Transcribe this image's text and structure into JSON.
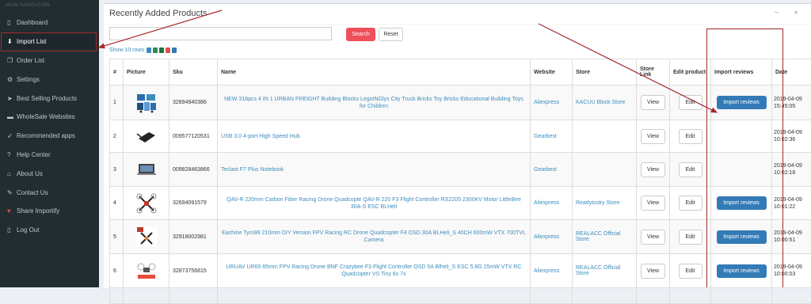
{
  "sidebar": {
    "header": "MAIN NAVIGATION",
    "items": [
      {
        "label": "Dashboard",
        "icon": "square-icon",
        "glyph": "▯"
      },
      {
        "label": "Import List",
        "icon": "download-icon",
        "glyph": "⬇"
      },
      {
        "label": "Order List",
        "icon": "copy-icon",
        "glyph": "❐"
      },
      {
        "label": "Settings",
        "icon": "gear-icon",
        "glyph": "⚙"
      },
      {
        "label": "Best Selling Products",
        "icon": "tag-icon",
        "glyph": "➤"
      },
      {
        "label": "WholeSale Websites",
        "icon": "folder-icon",
        "glyph": "▬"
      },
      {
        "label": "Recommended apps",
        "icon": "rocket-icon",
        "glyph": "➶"
      },
      {
        "label": "Help Center",
        "icon": "question-icon",
        "glyph": "?"
      },
      {
        "label": "About Us",
        "icon": "home-icon",
        "glyph": "⌂"
      },
      {
        "label": "Contact Us",
        "icon": "edit-icon",
        "glyph": "✎"
      },
      {
        "label": "Share Importify",
        "icon": "heart-icon",
        "glyph": "♥"
      },
      {
        "label": "Log Out",
        "icon": "square-icon",
        "glyph": "▯"
      }
    ]
  },
  "panel": {
    "title": "Recently Added Products",
    "minimize": "−",
    "close": "×",
    "search_placeholder": "",
    "search_label": "Search",
    "reset_label": "Reset",
    "show_rows": "Show 10 rows"
  },
  "table": {
    "headers": [
      "#",
      "Picture",
      "Sku",
      "Name",
      "Website",
      "Store",
      "Store Link",
      "Edit product",
      "Import reviews",
      "Date"
    ],
    "view_label": "View",
    "edit_label": "Edit",
    "import_label": "Import reviews",
    "rows": [
      {
        "num": "1",
        "sku": "32894940386",
        "name": "NEW 318pcs 4 IN 1 URBAN FREIGHT Building Blocks LegoINGlys City Truck Bricks Toy Bricks Educational Building Toys for Children",
        "website": "Aliexpress",
        "store": "KACUU Block Store",
        "has_import": true,
        "date": "2019-04-09 15:45:05"
      },
      {
        "num": "2",
        "sku": "009577120531",
        "name": "USB 3.0 4-port High Speed Hub",
        "website": "Gearbest",
        "store": "",
        "has_import": false,
        "date": "2019-04-09 10:02:36"
      },
      {
        "num": "3",
        "sku": "009828463866",
        "name": "Teclast F7 Plus Notebook",
        "website": "Gearbest",
        "store": "",
        "has_import": false,
        "date": "2019-04-09 10:02:18"
      },
      {
        "num": "4",
        "sku": "32694091579",
        "name": "QAV-R 220mm Carbon Fiber Racing Drone Quadcopte QAV-R 220 F3 Flight Controller RS2205 2300KV Motor LittleBee 30A-S ESC BLHeli",
        "website": "Aliexpress",
        "store": "Readytosky Store",
        "has_import": true,
        "date": "2019-04-09 10:01:22"
      },
      {
        "num": "5",
        "sku": "32918002981",
        "name": "Eachine Tyro99 210mm DIY Version FPV Racing RC Drone Quadcopter F4 OSD 30A BLHeli_S 40CH 600mW VTX 700TVL Camera",
        "website": "Aliexpress",
        "store": "REALACC Official Store",
        "has_import": true,
        "date": "2019-04-09 10:00:51"
      },
      {
        "num": "6",
        "sku": "32873756815",
        "name": "URUAV UR65 65mm FPV Racing Drone BNF Crazybee F3 Flight Controller OSD 5A Blheli_S ESC 5.8G 25mW VTX RC Quadcopter VS Tiny 6x 7x",
        "website": "Aliexpress",
        "store": "REALACC Official Store",
        "has_import": true,
        "date": "2019-04-09 10:00:03"
      }
    ]
  },
  "colors": {
    "sidebar_bg": "#222d32",
    "search_button": "#ef4e5a",
    "import_button": "#337ab7",
    "link": "#3c8dbc",
    "annotation": "#a52a2a"
  }
}
